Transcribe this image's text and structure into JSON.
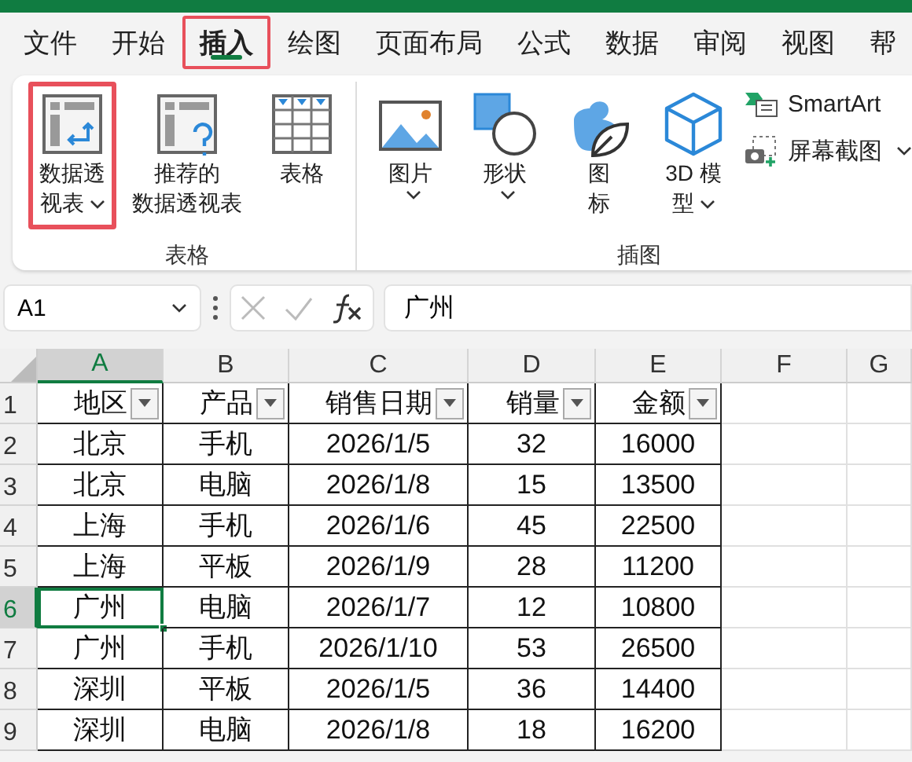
{
  "menu_tabs": [
    {
      "label": "文件",
      "selected": false,
      "highlighted": false
    },
    {
      "label": "开始",
      "selected": false,
      "highlighted": false
    },
    {
      "label": "插入",
      "selected": true,
      "highlighted": true
    },
    {
      "label": "绘图",
      "selected": false,
      "highlighted": false
    },
    {
      "label": "页面布局",
      "selected": false,
      "highlighted": false
    },
    {
      "label": "公式",
      "selected": false,
      "highlighted": false
    },
    {
      "label": "数据",
      "selected": false,
      "highlighted": false
    },
    {
      "label": "审阅",
      "selected": false,
      "highlighted": false
    },
    {
      "label": "视图",
      "selected": false,
      "highlighted": false
    },
    {
      "label": "帮",
      "selected": false,
      "highlighted": false
    }
  ],
  "ribbon_groups": [
    {
      "label": "表格",
      "items": [
        {
          "kind": "pivot",
          "lines": [
            "数据透",
            "视表"
          ],
          "dropdown": true,
          "highlighted": true
        },
        {
          "kind": "recommended",
          "lines": [
            "推荐的",
            "数据透视表"
          ],
          "dropdown": false,
          "highlighted": false
        },
        {
          "kind": "table",
          "lines": [
            "表格"
          ],
          "dropdown": false,
          "highlighted": false
        }
      ]
    },
    {
      "label": "插图",
      "items": [
        {
          "kind": "picture",
          "lines": [
            "图片"
          ],
          "dropdown": true,
          "highlighted": false
        },
        {
          "kind": "shapes",
          "lines": [
            "形状"
          ],
          "dropdown": true,
          "highlighted": false
        },
        {
          "kind": "icons",
          "lines": [
            "图",
            "标"
          ],
          "dropdown": false,
          "highlighted": false
        },
        {
          "kind": "model3d",
          "lines": [
            "3D 模",
            "型"
          ],
          "dropdown": true,
          "highlighted": false
        }
      ],
      "small_items": [
        {
          "kind": "smartart",
          "label": "SmartArt",
          "dropdown": false
        },
        {
          "kind": "screenshot",
          "label": "屏幕截图",
          "dropdown": true
        }
      ]
    }
  ],
  "formula_bar": {
    "name_box": "A1",
    "value": "广州"
  },
  "sheet": {
    "columns": [
      {
        "label": "A",
        "selected": true
      },
      {
        "label": "B",
        "selected": false
      },
      {
        "label": "C",
        "selected": false
      },
      {
        "label": "D",
        "selected": false
      },
      {
        "label": "E",
        "selected": false
      },
      {
        "label": "F",
        "selected": false
      },
      {
        "label": "G",
        "selected": false
      }
    ],
    "header_row": {
      "number": "1",
      "cells": [
        "地区",
        "产品",
        "销售日期",
        "销量",
        "金额"
      ]
    },
    "rows": [
      {
        "number": "2",
        "selected": false,
        "cells": [
          "北京",
          "手机",
          "2026/1/5",
          "32",
          "16000"
        ]
      },
      {
        "number": "3",
        "selected": false,
        "cells": [
          "北京",
          "电脑",
          "2026/1/8",
          "15",
          "13500"
        ]
      },
      {
        "number": "4",
        "selected": false,
        "cells": [
          "上海",
          "手机",
          "2026/1/6",
          "45",
          "22500"
        ]
      },
      {
        "number": "5",
        "selected": false,
        "cells": [
          "上海",
          "平板",
          "2026/1/9",
          "28",
          "11200"
        ]
      },
      {
        "number": "6",
        "selected": true,
        "cells": [
          "广州",
          "电脑",
          "2026/1/7",
          "12",
          "10800"
        ]
      },
      {
        "number": "7",
        "selected": false,
        "cells": [
          "广州",
          "手机",
          "2026/1/10",
          "53",
          "26500"
        ]
      },
      {
        "number": "8",
        "selected": false,
        "cells": [
          "深圳",
          "平板",
          "2026/1/5",
          "36",
          "14400"
        ]
      },
      {
        "number": "9",
        "selected": false,
        "cells": [
          "深圳",
          "电脑",
          "2026/1/8",
          "18",
          "16200"
        ]
      }
    ]
  }
}
